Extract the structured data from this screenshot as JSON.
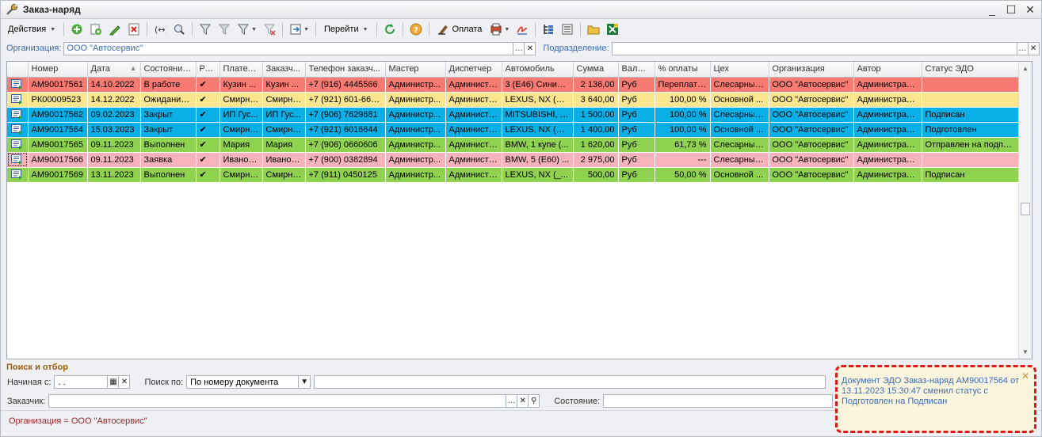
{
  "window": {
    "title": "Заказ-наряд"
  },
  "toolbar": {
    "actions_label": "Действия",
    "payment_label": "Оплата",
    "goto_label": "Перейти"
  },
  "filter": {
    "org_label": "Организация:",
    "org_value": "ООО \"Автосервис\"",
    "dept_label": "Подразделение:",
    "dept_value": ""
  },
  "table": {
    "columns": [
      "Номер",
      "Дата",
      "Состояние...",
      "Ре...",
      "Плател...",
      "Заказч...",
      "Телефон заказч...",
      "Мастер",
      "Диспетчер",
      "Автомобиль",
      "Сумма",
      "Валюта",
      "% оплаты",
      "Цех",
      "Организация",
      "Автор",
      "Статус ЭДО"
    ],
    "rows": [
      {
        "color": "red",
        "cells": [
          "АМ90017561",
          "14.10.2022",
          "В работе",
          "✔",
          "Кузин ...",
          "Кузин ...",
          "+7 (916) 4445566",
          "Администр...",
          "Администр...",
          "3 (E46) Синий ...",
          "2 136,00",
          "Руб",
          "Переплата...",
          "Слесарный...",
          "ООО \"Автосервис\"",
          "Администратор",
          ""
        ]
      },
      {
        "color": "yellow",
        "cells": [
          "РК00009523",
          "14.12.2022",
          "Ожидание ...",
          "✔",
          "Смирно...",
          "Смирно...",
          "+7 (921) 601-66-44",
          "Администр...",
          "Администр...",
          "LEXUS, NX (_Z...",
          "3 640,00",
          "Руб",
          "100,00 %",
          "Основной ...",
          "ООО \"Автосервис\"",
          "Администратор",
          ""
        ]
      },
      {
        "color": "blue",
        "cells": [
          "АМ90017562",
          "09.02.2023",
          "Закрыт",
          "✔",
          "ИП Гус...",
          "ИП Гус...",
          "+7 (906) 7629681",
          "Администр...",
          "Администр...",
          "MITSUBISHI, L...",
          "1 500,00",
          "Руб",
          "100,00 %",
          "Слесарный...",
          "ООО \"Автосервис\"",
          "Администратор",
          "Подписан"
        ]
      },
      {
        "color": "blue",
        "cells": [
          "АМ90017564",
          "15.03.2023",
          "Закрыт",
          "✔",
          "Смирно...",
          "Смирно...",
          "+7 (921) 6016644",
          "Администр...",
          "Администр...",
          "LEXUS, NX (_Z...",
          "1 400,00",
          "Руб",
          "100,00 %",
          "Основной ...",
          "ООО \"Автосервис\"",
          "Администратор",
          "Подготовлен"
        ]
      },
      {
        "color": "green",
        "cells": [
          "АМ90017565",
          "09.11.2023",
          "Выполнен",
          "✔",
          "Мария",
          "Мария",
          "+7 (906) 0660606",
          "Администр...",
          "Администр...",
          "BMW, 1 купе (...",
          "1 620,00",
          "Руб",
          "61,73 %",
          "Слесарный...",
          "ООО \"Автосервис\"",
          "Администратор",
          "Отправлен на подпись"
        ]
      },
      {
        "color": "pink",
        "cells": [
          "АМ90017566",
          "09.11.2023",
          "Заявка",
          "✔",
          "Иванов...",
          "Иванов...",
          "+7 (900) 0382894",
          "Администр...",
          "Администр...",
          "BMW, 5 (E60) ...",
          "2 975,00",
          "Руб",
          "---",
          "Слесарный...",
          "ООО \"Автосервис\"",
          "Администратор",
          ""
        ]
      },
      {
        "color": "green",
        "cells": [
          "АМ90017569",
          "13.11.2023",
          "Выполнен",
          "✔",
          "Смирно...",
          "Смирно...",
          "+7 (911) 0450125",
          "Администр...",
          "Администр...",
          "LEXUS, NX (_...",
          "500,00",
          "Руб",
          "50,00 %",
          "Основной ...",
          "ООО \"Автосервис\"",
          "Администратор",
          "Подписан"
        ]
      }
    ]
  },
  "search": {
    "title": "Поиск и отбор",
    "start_label": "Начиная с:",
    "start_value": ". .",
    "search_by_label": "Поиск по:",
    "search_by_value": "По номеру документа",
    "search_text": "",
    "customer_label": "Заказчик:",
    "customer_value": "",
    "state_label": "Состояние:",
    "state_value": ""
  },
  "status": {
    "text": "Организация = ООО \"Автосервис\""
  },
  "notification": {
    "message": "Документ ЭДО Заказ-наряд АМ90017564 от 13.11.2023 15:30:47 сменил статус с Подготовлен на Подписан"
  },
  "colors": {
    "red": "#f87b73",
    "yellow": "#fbe58f",
    "blue": "#0aafe8",
    "green": "#8fd24f",
    "pink": "#f8b2bb",
    "label_blue": "#3b6bb4",
    "section_orange": "#a25e0c",
    "status_red": "#a2262b"
  },
  "icons": [
    "wrench-icon",
    "add-icon",
    "copy-icon",
    "edit-icon",
    "delete-icon",
    "refresh-fields-icon",
    "search-icon",
    "filter-icon",
    "goto-icon",
    "reload-icon",
    "help-icon",
    "payment-icon",
    "print-icon",
    "tree-icon",
    "list-icon",
    "folder-icon",
    "excel-icon"
  ]
}
